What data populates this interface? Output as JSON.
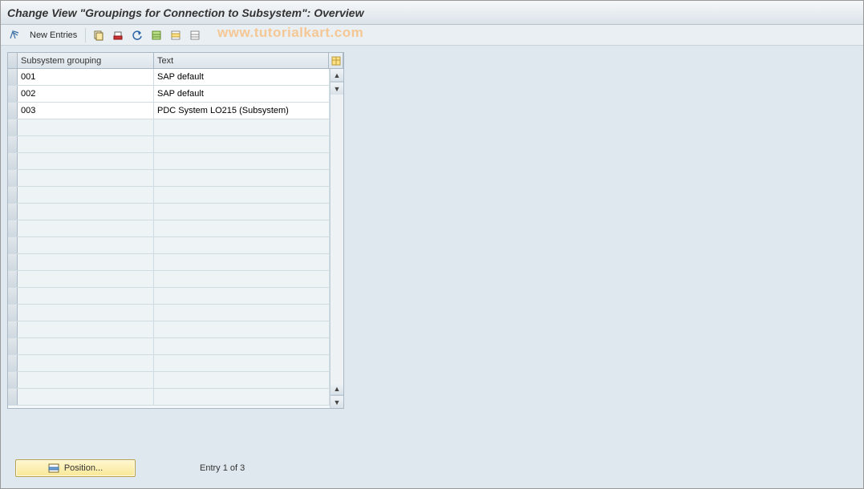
{
  "header": {
    "title": "Change View \"Groupings for Connection to Subsystem\": Overview"
  },
  "toolbar": {
    "new_entries_label": "New Entries",
    "icons": {
      "toggle": "toggle-icon",
      "copy": "copy-icon",
      "delete": "delete-icon",
      "undo": "undo-icon",
      "select_all": "select-all-icon",
      "select_block": "select-block-icon",
      "deselect_all": "deselect-all-icon"
    }
  },
  "watermark": "www.tutorialkart.com",
  "table": {
    "columns": {
      "grouping": "Subsystem grouping",
      "text": "Text"
    },
    "config_icon": "table-settings-icon",
    "rows": [
      {
        "grouping": "001",
        "text": "SAP default"
      },
      {
        "grouping": "002",
        "text": "SAP default"
      },
      {
        "grouping": "003",
        "text": "PDC System LO215 (Subsystem)"
      }
    ],
    "empty_row_count": 17
  },
  "footer": {
    "position_label": "Position...",
    "entry_status": "Entry 1 of 3"
  }
}
